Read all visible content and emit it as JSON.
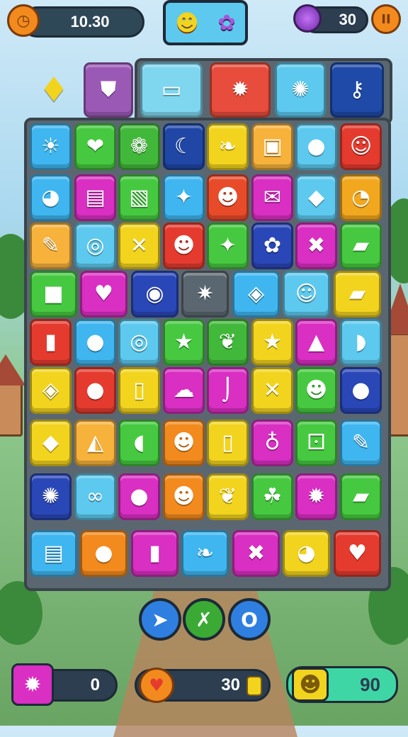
{
  "hud": {
    "timer": "10.30",
    "timer_icon": "clock-icon",
    "center_icons": [
      "monster-face-icon",
      "purple-creature-icon"
    ],
    "gem_icon": "purple-gem-icon",
    "gem_count": "30",
    "pause_label": "II"
  },
  "goal_tiles": [
    {
      "icon": "yellow-gem-icon",
      "glyph": "♦",
      "color": ""
    },
    {
      "icon": "shield-icon",
      "glyph": "⛊",
      "color": "#9b59b6"
    },
    {
      "icon": "ticket-icon",
      "glyph": "▭",
      "color": "#7fd6ef"
    },
    {
      "icon": "sun-emblem-icon",
      "glyph": "✹",
      "color": "#e74c3c"
    },
    {
      "icon": "spiky-ball-icon",
      "glyph": "✺",
      "color": "#5dc9ee"
    },
    {
      "icon": "key-icon",
      "glyph": "⚷",
      "color": "#1f4aa8"
    }
  ],
  "board": [
    [
      {
        "icon": "sun-icon",
        "glyph": "☀",
        "color": "#3fb6f0"
      },
      {
        "icon": "leaf-heart-icon",
        "glyph": "❤",
        "color": "#46c940"
      },
      {
        "icon": "onion-icon",
        "glyph": "❁",
        "color": "#42b83b"
      },
      {
        "icon": "banana-icon",
        "glyph": "☾",
        "color": "#2047a6"
      },
      {
        "icon": "pickle-icon",
        "glyph": "❧",
        "color": "#f2d41e"
      },
      {
        "icon": "box-icon",
        "glyph": "▣",
        "color": "#f7b23b"
      },
      {
        "icon": "lollipop-icon",
        "glyph": "●",
        "color": "#5dc9ee"
      },
      {
        "icon": "smiley-icon",
        "glyph": "☺",
        "color": "#e53b2f"
      }
    ],
    [
      {
        "icon": "turtle-icon",
        "glyph": "◕",
        "color": "#3fb6f0"
      },
      {
        "icon": "book-icon",
        "glyph": "▤",
        "color": "#d92fc2"
      },
      {
        "icon": "picture-icon",
        "glyph": "▧",
        "color": "#46c940"
      },
      {
        "icon": "star-burst-icon",
        "glyph": "✦",
        "color": "#3fb6f0"
      },
      {
        "icon": "cat-face-icon",
        "glyph": "☻",
        "color": "#e84b2a"
      },
      {
        "icon": "envelope-icon",
        "glyph": "✉",
        "color": "#d92fc2"
      },
      {
        "icon": "purple-block-icon",
        "glyph": "◆",
        "color": "#5dc9ee"
      },
      {
        "icon": "whistle-icon",
        "glyph": "◔",
        "color": "#f2a81e"
      }
    ],
    [
      {
        "icon": "pencil-icon",
        "glyph": "✎",
        "color": "#f7b23b"
      },
      {
        "icon": "ring-icon",
        "glyph": "◎",
        "color": "#5dc9ee"
      },
      {
        "icon": "cross-icon",
        "glyph": "✕",
        "color": "#f2d41e"
      },
      {
        "icon": "devil-face-icon",
        "glyph": "☻",
        "color": "#e53b2f"
      },
      {
        "icon": "blue-star-icon",
        "glyph": "✦",
        "color": "#46c940"
      },
      {
        "icon": "maple-leaf-icon",
        "glyph": "✿",
        "color": "#2a47b8"
      },
      {
        "icon": "purple-x-icon",
        "glyph": "✖",
        "color": "#d92fc2"
      },
      {
        "icon": "bottle-icon",
        "glyph": "▰",
        "color": "#46c940"
      }
    ],
    [
      {
        "icon": "red-cube-icon",
        "glyph": "■",
        "color": "#46c940"
      },
      {
        "icon": "orange-heart-icon",
        "glyph": "♥",
        "color": "#d92fc2"
      },
      {
        "icon": "eye-orb-icon",
        "glyph": "◉",
        "color": "#2a47b8"
      },
      {
        "icon": "sparkle-icon",
        "glyph": "✷",
        "color": "#5b6770"
      },
      {
        "icon": "gold-box-icon",
        "glyph": "◈",
        "color": "#3fb6f0"
      },
      {
        "icon": "smiley-icon",
        "glyph": "☺",
        "color": "#5dc9ee"
      },
      {
        "icon": "purple-slab-icon",
        "glyph": "▰",
        "color": "#f2d41e"
      }
    ],
    [
      {
        "icon": "red-blocks-icon",
        "glyph": "▮",
        "color": "#e53b2f"
      },
      {
        "icon": "green-blob-icon",
        "glyph": "●",
        "color": "#3fb6f0"
      },
      {
        "icon": "spiral-icon",
        "glyph": "◎",
        "color": "#5dc9ee"
      },
      {
        "icon": "yellow-star-icon",
        "glyph": "★",
        "color": "#46c940"
      },
      {
        "icon": "paw-icon",
        "glyph": "❦",
        "color": "#42b83b"
      },
      {
        "icon": "pink-star-icon",
        "glyph": "★",
        "color": "#f2d41e"
      },
      {
        "icon": "bell-icon",
        "glyph": "▲",
        "color": "#d92fc2"
      },
      {
        "icon": "hat-icon",
        "glyph": "◗",
        "color": "#5dc9ee"
      }
    ],
    [
      {
        "icon": "gold-box-icon",
        "glyph": "◈",
        "color": "#f2d41e"
      },
      {
        "icon": "red-apple-icon",
        "glyph": "●",
        "color": "#e53b2f"
      },
      {
        "icon": "paper-icon",
        "glyph": "▯",
        "color": "#f2d41e"
      },
      {
        "icon": "pink-blob-icon",
        "glyph": "☁",
        "color": "#d92fc2"
      },
      {
        "icon": "hook-icon",
        "glyph": "⌡",
        "color": "#d92fc2"
      },
      {
        "icon": "blue-x-icon",
        "glyph": "✕",
        "color": "#f2d41e"
      },
      {
        "icon": "orange-face-icon",
        "glyph": "☻",
        "color": "#46c940"
      },
      {
        "icon": "purple-balloon-icon",
        "glyph": "●",
        "color": "#2a47b8"
      }
    ],
    [
      {
        "icon": "blue-diamond-icon",
        "glyph": "◆",
        "color": "#f2d41e"
      },
      {
        "icon": "cheese-icon",
        "glyph": "◭",
        "color": "#f7b23b"
      },
      {
        "icon": "tag-icon",
        "glyph": "◖",
        "color": "#46c940"
      },
      {
        "icon": "pig-face-icon",
        "glyph": "☻",
        "color": "#f28a1e"
      },
      {
        "icon": "cup-icon",
        "glyph": "▯",
        "color": "#f2d41e"
      },
      {
        "icon": "potion-icon",
        "glyph": "♁",
        "color": "#d92fc2"
      },
      {
        "icon": "dice-icon",
        "glyph": "⚀",
        "color": "#46c940"
      },
      {
        "icon": "crayon-icon",
        "glyph": "✎",
        "color": "#3fb6f0"
      }
    ],
    [
      {
        "icon": "spiky-ball-icon",
        "glyph": "✺",
        "color": "#2a47b8"
      },
      {
        "icon": "chain-icon",
        "glyph": "∞",
        "color": "#5dc9ee"
      },
      {
        "icon": "balloon-icon",
        "glyph": "●",
        "color": "#d92fc2"
      },
      {
        "icon": "yellow-bear-icon",
        "glyph": "☻",
        "color": "#f28a1e"
      },
      {
        "icon": "squirrel-icon",
        "glyph": "❦",
        "color": "#f2d41e"
      },
      {
        "icon": "green-frog-icon",
        "glyph": "☘",
        "color": "#46c940"
      },
      {
        "icon": "gear-icon",
        "glyph": "✹",
        "color": "#d92fc2"
      },
      {
        "icon": "cart-icon",
        "glyph": "▰",
        "color": "#46c940"
      }
    ],
    [
      {
        "icon": "notebook-icon",
        "glyph": "▤",
        "color": "#3fb6f0"
      },
      {
        "icon": "green-balloon-icon",
        "glyph": "●",
        "color": "#f28a1e"
      },
      {
        "icon": "lipstick-icon",
        "glyph": "▮",
        "color": "#d92fc2"
      },
      {
        "icon": "gecko-icon",
        "glyph": "❧",
        "color": "#3fb6f0"
      },
      {
        "icon": "tools-icon",
        "glyph": "✖",
        "color": "#d92fc2"
      },
      {
        "icon": "magnifier-icon",
        "glyph": "◕",
        "color": "#f2d41e"
      },
      {
        "icon": "heart-icon",
        "glyph": "♥",
        "color": "#e53b2f"
      }
    ]
  ],
  "powerups": [
    {
      "icon": "arrow-icon",
      "glyph": "➤",
      "color": "#2f7fe0"
    },
    {
      "icon": "x-bomb-icon",
      "glyph": "✗",
      "color": "#3aaa35"
    },
    {
      "icon": "ring-icon",
      "glyph": "O",
      "color": "#2f7fe0"
    }
  ],
  "bottom_bar": {
    "left": {
      "icon": "gear-icon",
      "glyph": "✹",
      "value": "0",
      "color": "#d92fc2"
    },
    "center": {
      "icon": "shield-heart-icon",
      "glyph": "♥",
      "value": "30",
      "color": "#f28a1e"
    },
    "right": {
      "icon": "face-ticket-icon",
      "glyph": "☻",
      "value": "90",
      "color": "#3fd6a5"
    }
  }
}
